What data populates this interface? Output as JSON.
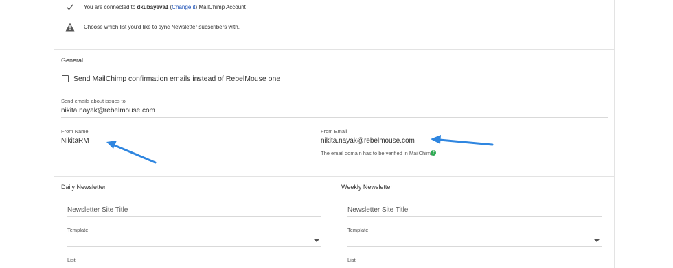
{
  "status": {
    "connected_prefix": "You are connected to ",
    "account_name": "dkubayeva1",
    "paren_open": " (",
    "change_link": "Change it",
    "connected_suffix": ") MailChimp Account",
    "warning_text": "Choose which list you'd like to sync Newsletter subscribers with."
  },
  "general": {
    "title": "General",
    "confirm_checkbox_label": "Send MailChimp confirmation emails instead of RebelMouse one",
    "issues_email_label": "Send emails about issues to",
    "issues_email_value": "nikita.nayak@rebelmouse.com",
    "from_name_label": "From Name",
    "from_name_value": "NikitaRM",
    "from_email_label": "From Email",
    "from_email_value": "nikita.nayak@rebelmouse.com",
    "from_email_hint": "The email domain has to be verified in MailChimp"
  },
  "daily": {
    "title": "Daily Newsletter",
    "site_title_placeholder": "Newsletter Site Title",
    "template_label": "Template",
    "list_label": "List"
  },
  "weekly": {
    "title": "Weekly Newsletter",
    "site_title_placeholder": "Newsletter Site Title",
    "template_label": "Template",
    "list_label": "List"
  },
  "colors": {
    "arrow": "#2f86e0",
    "link": "#1a4fb5",
    "help_icon": "#2eaa52"
  }
}
